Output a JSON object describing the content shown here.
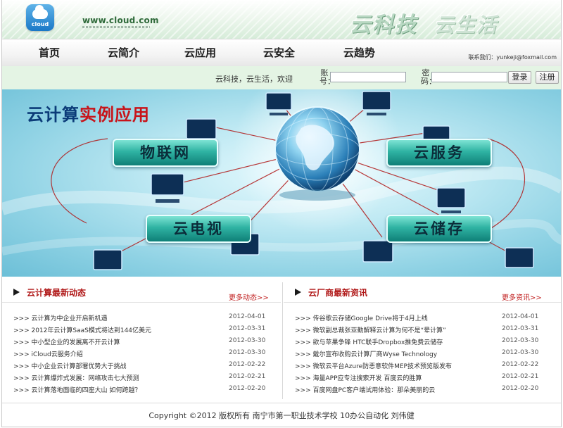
{
  "header": {
    "logo_text": "cloud",
    "site_url": "www.cloud.com",
    "slogans": [
      "云科技",
      "云生活"
    ]
  },
  "nav": {
    "items": [
      "首页",
      "云简介",
      "云应用",
      "云安全",
      "云趋势"
    ],
    "contact": "联系我们：yunkeji@foxmail.com"
  },
  "login": {
    "welcome": "云科技，云生活，欢迎",
    "account_label": "账号：",
    "password_label": "密码：",
    "account_value": "",
    "password_value": "",
    "login_button": "登录",
    "register_button": "注册"
  },
  "banner": {
    "title_part1": "云计算",
    "title_part2": "实例应用",
    "buttons": [
      "物联网",
      "云服务",
      "云电视",
      "云储存"
    ]
  },
  "news_left": {
    "title": "云计算最新动态",
    "more": "更多动态>>",
    "items": [
      {
        "title": ">>>  云计算为中企业开启新机遇",
        "date": "2012-04-01"
      },
      {
        "title": ">>>  2012年云计算SaaS模式将达到144亿美元",
        "date": "2012-03-31"
      },
      {
        "title": ">>>  中小型企业的发展离不开云计算",
        "date": "2012-03-30"
      },
      {
        "title": ">>>  iCloud云服务介绍",
        "date": "2012-03-30"
      },
      {
        "title": ">>>  中小企业云计算部署优势大于挑战",
        "date": "2012-02-22"
      },
      {
        "title": ">>>  云计算爆炸式发展：网络攻击七大预测",
        "date": "2012-02-21"
      },
      {
        "title": ">>>  云计算落地面临的四座大山 如何跨越？",
        "date": "2012-02-20"
      }
    ]
  },
  "news_right": {
    "title": "云厂商最新资讯",
    "more": "更多资讯>>",
    "items": [
      {
        "title": ">>>  传谷歌云存储Google Drive将于4月上线",
        "date": "2012-04-01"
      },
      {
        "title": ">>>  微软副总裁张亚勤解释云计算为何不是“晕计算”",
        "date": "2012-03-31"
      },
      {
        "title": ">>>  欲与苹果争锋 HTC联手Dropbox推免费云储存",
        "date": "2012-03-30"
      },
      {
        "title": ">>>  戴尔宣布收购云计算厂商Wyse Technology",
        "date": "2012-03-30"
      },
      {
        "title": ">>>  微软云平台Azure防恶意软件MEP技术预览版发布",
        "date": "2012-02-22"
      },
      {
        "title": ">>>  海量APP应专注搜索开发 百度云的胜算",
        "date": "2012-02-21"
      },
      {
        "title": ">>>  百度网盘PC客户端试用体验：那朵美丽的云",
        "date": "2012-02-20"
      }
    ]
  },
  "footer": {
    "text": "Copyright ©2012 版权所有 南宁市第一职业技术学校 10办公自动化 刘伟健"
  },
  "colors": {
    "accent_red": "#c8141a",
    "banner_blue": "#0b3b78",
    "login_bar": "#e4f4e4"
  }
}
